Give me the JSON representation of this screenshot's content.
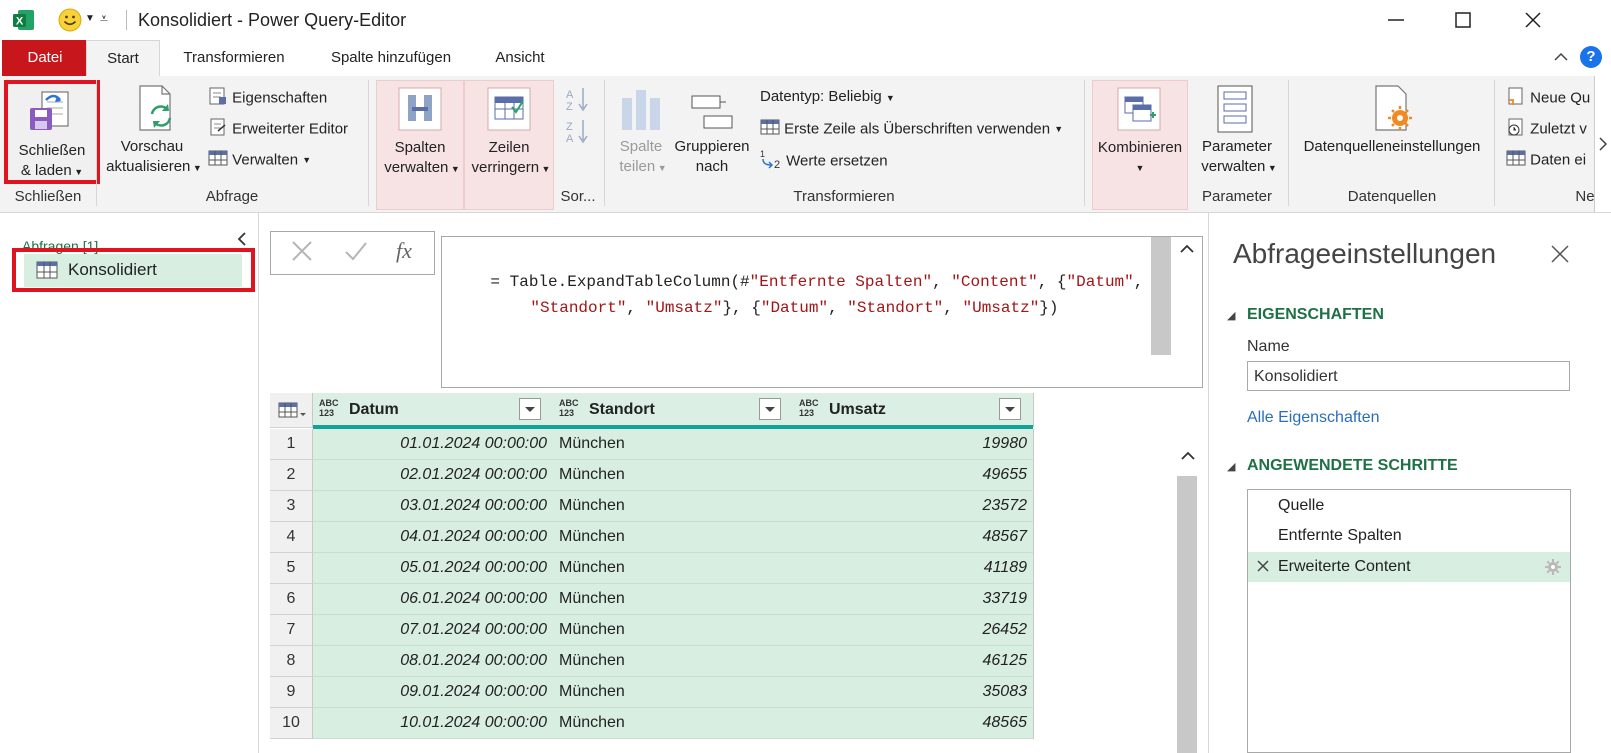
{
  "window": {
    "title": "Konsolidiert - Power Query-Editor"
  },
  "tabs": [
    {
      "label": "Datei"
    },
    {
      "label": "Start"
    },
    {
      "label": "Transformieren"
    },
    {
      "label": "Spalte hinzufügen"
    },
    {
      "label": "Ansicht"
    }
  ],
  "ribbon": {
    "schliessen": {
      "btn_line1": "Schließen",
      "btn_line2": "& laden",
      "group": "Schließen"
    },
    "abfrage": {
      "vorschau_line1": "Vorschau",
      "vorschau_line2": "aktualisieren",
      "eigenschaften": "Eigenschaften",
      "erweiterter_editor": "Erweiterter Editor",
      "verwalten": "Verwalten",
      "group": "Abfrage"
    },
    "spalten": {
      "line1": "Spalten",
      "line2": "verwalten"
    },
    "zeilen": {
      "line1": "Zeilen",
      "line2": "verringern"
    },
    "sort_group": "Sor...",
    "transformieren": {
      "spalte_line1": "Spalte",
      "spalte_line2": "teilen",
      "gruppieren_line1": "Gruppieren",
      "gruppieren_line2": "nach",
      "datentyp": "Datentyp: Beliebig",
      "erste_zeile": "Erste Zeile als Überschriften verwenden",
      "werte_ersetzen": "Werte ersetzen",
      "group": "Transformieren"
    },
    "kombinieren": {
      "label": "Kombinieren"
    },
    "parameter": {
      "line1": "Parameter",
      "line2": "verwalten",
      "group": "Parameter"
    },
    "datenquellen": {
      "label": "Datenquelleneinstellungen",
      "group": "Datenquellen"
    },
    "neu": {
      "neue": "Neue Qu",
      "zuletzt": "Zuletzt v",
      "daten": "Daten ei",
      "group": "Ne"
    }
  },
  "queries": {
    "header": "Abfragen [1]",
    "items": [
      {
        "label": "Konsolidiert"
      }
    ]
  },
  "formula": {
    "line1_prefix": "= Table.ExpandTableColumn(#",
    "line1_s1": "\"Entfernte Spalten\"",
    "line1_sep1": ", ",
    "line1_s2": "\"Content\"",
    "line1_sep2": ", {",
    "line1_s3": "\"Datum\"",
    "line1_sep3": ",",
    "line2_s1": "\"Standort\"",
    "line2_sep1": ", ",
    "line2_s2": "\"Umsatz\"",
    "line2_sep2": "}, {",
    "line2_s3": "\"Datum\"",
    "line2_sep3": ", ",
    "line2_s4": "\"Standort\"",
    "line2_sep4": ", ",
    "line2_s5": "\"Umsatz\"",
    "line2_end": "})",
    "fx": "fx"
  },
  "table": {
    "type_badge": "ABC\n123",
    "columns": [
      "Datum",
      "Standort",
      "Umsatz"
    ],
    "rows": [
      [
        "1",
        "01.01.2024 00:00:00",
        "München",
        "19980"
      ],
      [
        "2",
        "02.01.2024 00:00:00",
        "München",
        "49655"
      ],
      [
        "3",
        "03.01.2024 00:00:00",
        "München",
        "23572"
      ],
      [
        "4",
        "04.01.2024 00:00:00",
        "München",
        "48567"
      ],
      [
        "5",
        "05.01.2024 00:00:00",
        "München",
        "41189"
      ],
      [
        "6",
        "06.01.2024 00:00:00",
        "München",
        "33719"
      ],
      [
        "7",
        "07.01.2024 00:00:00",
        "München",
        "26452"
      ],
      [
        "8",
        "08.01.2024 00:00:00",
        "München",
        "46125"
      ],
      [
        "9",
        "09.01.2024 00:00:00",
        "München",
        "35083"
      ],
      [
        "10",
        "10.01.2024 00:00:00",
        "München",
        "48565"
      ]
    ]
  },
  "settings": {
    "title": "Abfrageeinstellungen",
    "eigenschaften": "EIGENSCHAFTEN",
    "name_label": "Name",
    "name_value": "Konsolidiert",
    "alle_eigenschaften": "Alle Eigenschaften",
    "schritte_title": "ANGEWENDETE SCHRITTE",
    "steps": [
      {
        "label": "Quelle"
      },
      {
        "label": "Entfernte Spalten"
      },
      {
        "label": "Erweiterte Content"
      }
    ]
  },
  "colors": {
    "accent_red": "#e0141e",
    "datei_red": "#c8161d",
    "green_text": "#1e7145",
    "selection_green": "#d8eee1"
  }
}
